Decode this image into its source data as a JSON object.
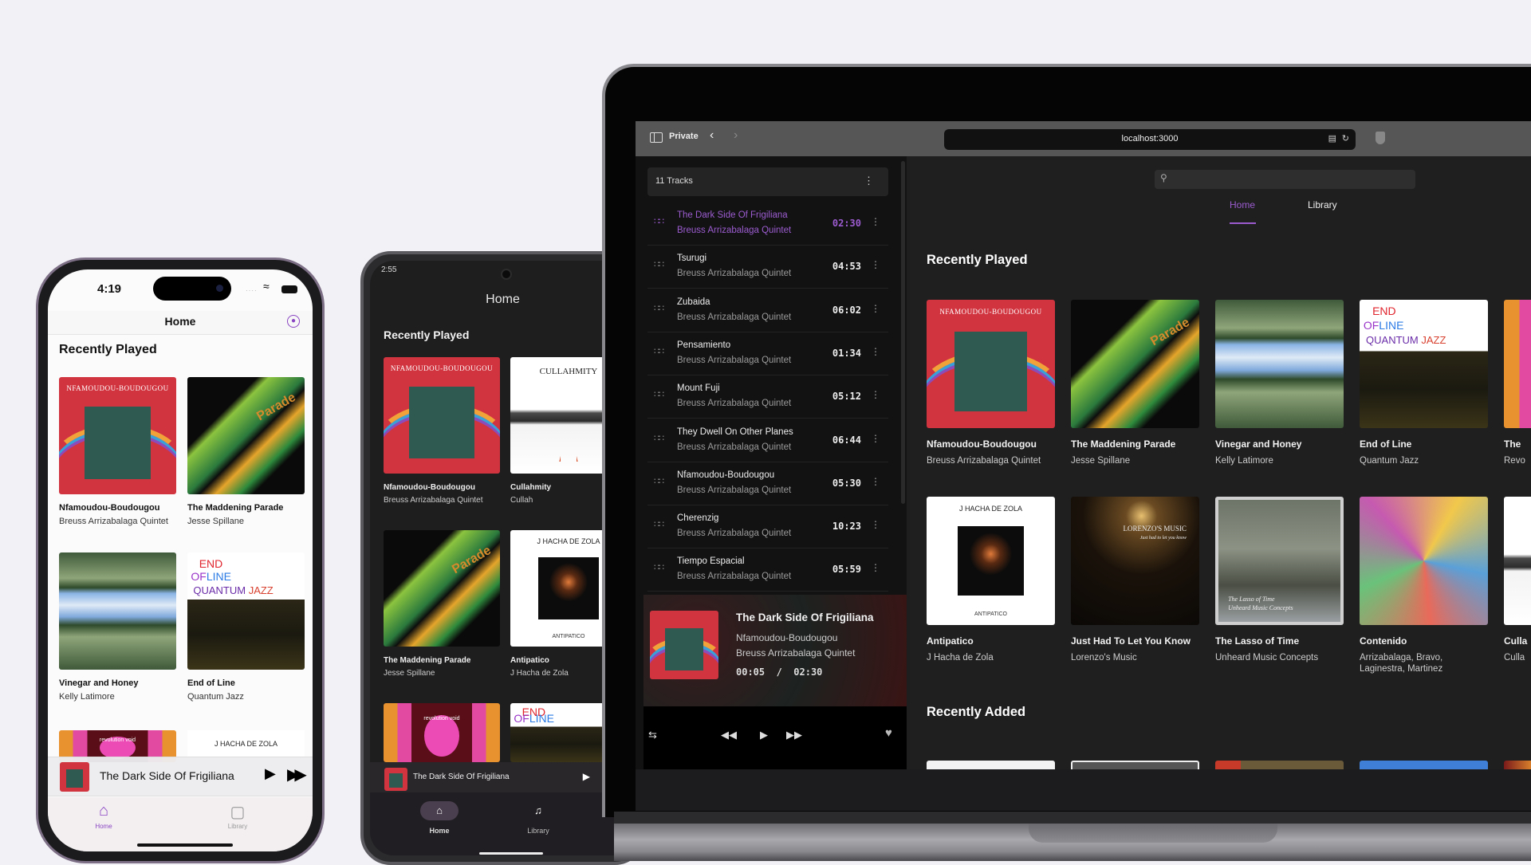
{
  "iphone": {
    "status_time": "4:19",
    "nav_title": "Home",
    "section_title": "Recently Played",
    "albums": [
      {
        "title": "Nfamoudou-Boudougou",
        "artist": "Breuss Arrizabalaga Quintet",
        "cover_text": "NFAMOUDOU-BOUDOUGOU"
      },
      {
        "title": "The Maddening Parade",
        "artist": "Jesse Spillane",
        "cover_text": "The Maddening Parade"
      },
      {
        "title": "Vinegar and Honey",
        "artist": "Kelly Latimore",
        "cover_text": ""
      },
      {
        "title": "End of Line",
        "artist": "Quantum Jazz",
        "cover_text": "END OF LINE QUANTUM JAZZ"
      }
    ],
    "partial_covers": [
      "revolution void",
      "J HACHA DE ZOLA"
    ],
    "mini_player": {
      "title": "The Dark Side Of Frigiliana"
    },
    "tabs": [
      {
        "label": "Home",
        "icon": "house-icon",
        "active": true
      },
      {
        "label": "Library",
        "icon": "library-icon",
        "active": false
      }
    ]
  },
  "android": {
    "status_time": "2:55",
    "nav_title": "Home",
    "section_title": "Recently Played",
    "albums": [
      {
        "title": "Nfamoudou-Boudougou",
        "artist": "Breuss Arrizabalaga Quintet"
      },
      {
        "title": "Cullahmity",
        "artist": "Cullah",
        "cover_text": "CULLAHMITY"
      },
      {
        "title": "The Maddening Parade",
        "artist": "Jesse Spillane"
      },
      {
        "title": "Antipatico",
        "artist": "J Hacha de Zola",
        "cover_text": "J HACHA DE ZOLA",
        "cover_sub": "ANTIPATICO"
      }
    ],
    "partial_covers": [
      "revolution void",
      "END OF LINE"
    ],
    "mini_player": {
      "title": "The Dark Side Of Frigiliana"
    },
    "tabs": [
      {
        "label": "Home",
        "icon": "house-icon",
        "active": true
      },
      {
        "label": "Library",
        "icon": "library-icon",
        "active": false
      }
    ]
  },
  "browser": {
    "mode_label": "Private",
    "url": "localhost:3000",
    "queue": {
      "header": "11 Tracks",
      "tracks": [
        {
          "title": "The Dark Side Of Frigiliana",
          "artist": "Breuss Arrizabalaga Quintet",
          "duration": "02:30",
          "active": true
        },
        {
          "title": "Tsurugi",
          "artist": "Breuss Arrizabalaga Quintet",
          "duration": "04:53"
        },
        {
          "title": "Zubaida",
          "artist": "Breuss Arrizabalaga Quintet",
          "duration": "06:02"
        },
        {
          "title": "Pensamiento",
          "artist": "Breuss Arrizabalaga Quintet",
          "duration": "01:34"
        },
        {
          "title": "Mount Fuji",
          "artist": "Breuss Arrizabalaga Quintet",
          "duration": "05:12"
        },
        {
          "title": "They Dwell On Other Planes",
          "artist": "Breuss Arrizabalaga Quintet",
          "duration": "06:44"
        },
        {
          "title": "Nfamoudou-Boudougou",
          "artist": "Breuss Arrizabalaga Quintet",
          "duration": "05:30"
        },
        {
          "title": "Cherenzig",
          "artist": "Breuss Arrizabalaga Quintet",
          "duration": "10:23"
        },
        {
          "title": "Tiempo Espacial",
          "artist": "Breuss Arrizabalaga Quintet",
          "duration": "05:59"
        }
      ]
    },
    "now_playing": {
      "title": "The Dark Side Of Frigiliana",
      "album": "Nfamoudou-Boudougou",
      "artist": "Breuss Arrizabalaga Quintet",
      "elapsed": "00:05",
      "separator": "/",
      "total": "02:30"
    },
    "tabs": [
      {
        "label": "Home",
        "active": true
      },
      {
        "label": "Library",
        "active": false
      }
    ],
    "recently_played_title": "Recently Played",
    "recently_added_title": "Recently Added",
    "row1": [
      {
        "title": "Nfamoudou-Boudougou",
        "artist": "Breuss Arrizabalaga Quintet"
      },
      {
        "title": "The Maddening Parade",
        "artist": "Jesse Spillane"
      },
      {
        "title": "Vinegar and Honey",
        "artist": "Kelly Latimore"
      },
      {
        "title": "End of Line",
        "artist": "Quantum Jazz"
      },
      {
        "title": "The",
        "artist": "Revo"
      }
    ],
    "row2": [
      {
        "title": "Antipatico",
        "artist": "J Hacha de Zola"
      },
      {
        "title": "Just Had To Let You Know",
        "artist": "Lorenzo's Music",
        "cover_text": "LORENZO'S MUSIC",
        "cover_sub": "Just had to let you know"
      },
      {
        "title": "The Lasso of Time",
        "artist": "Unheard Music Concepts",
        "cover_text": "The Lasso of Time",
        "cover_sub": "Unheard Music Concepts"
      },
      {
        "title": "Contenido",
        "artist": "Arrizabalaga, Bravo, Laginestra, Martinez"
      },
      {
        "title": "Culla",
        "artist": "Culla"
      }
    ]
  },
  "colors": {
    "accent": "#9c5cd0",
    "dark_bg": "#1f1f1f",
    "sidebar_bg": "#121212",
    "page_bg": "#f2f2f6"
  }
}
